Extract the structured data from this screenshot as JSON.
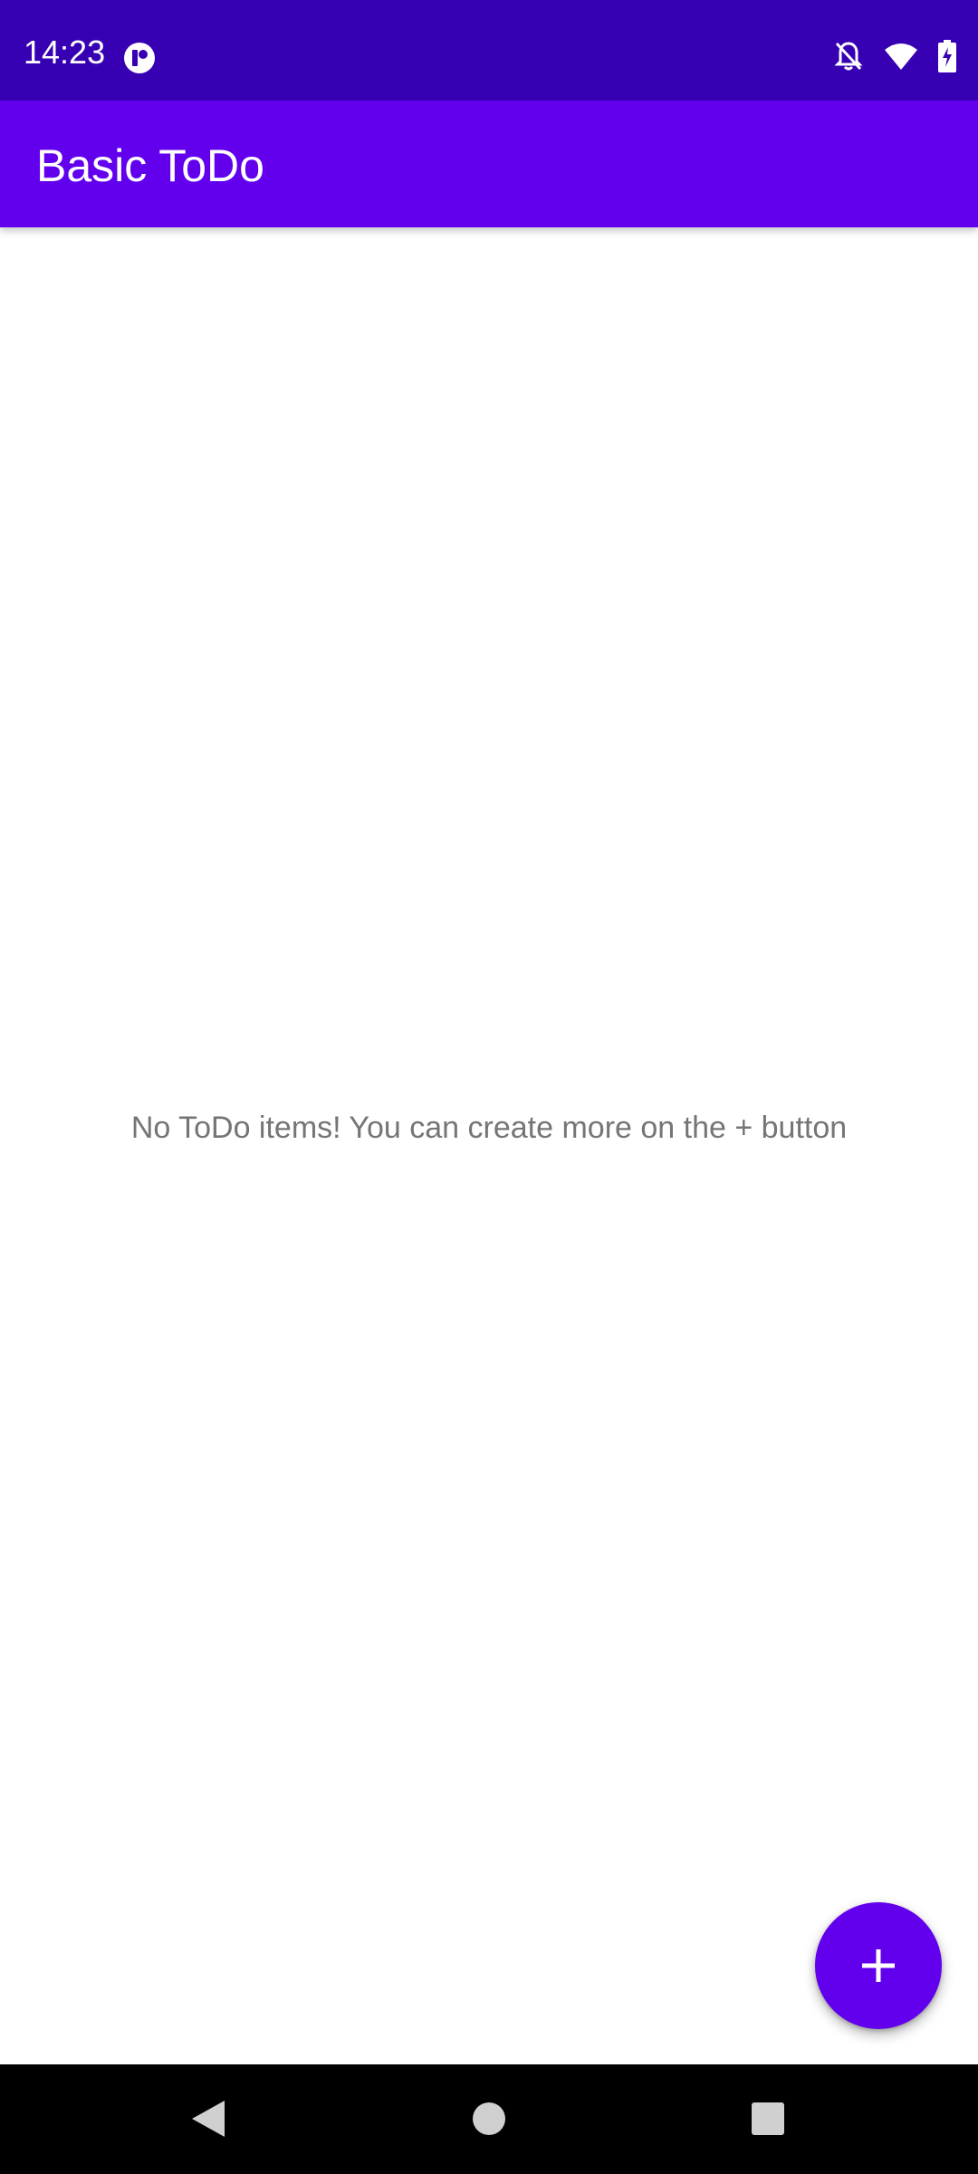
{
  "status_bar": {
    "time": "14:23",
    "bg_color": "#3700b3",
    "icons": [
      "app-notification-icon",
      "bell-off-icon",
      "wifi-icon",
      "battery-charging-icon"
    ]
  },
  "app_bar": {
    "title": "Basic ToDo",
    "bg_color": "#6200ee"
  },
  "main": {
    "empty_message": "No ToDo items! You can create more on the + button"
  },
  "fab": {
    "icon": "plus-icon",
    "color": "#6200ee"
  },
  "nav_bar": {
    "buttons": [
      "back-icon",
      "home-icon",
      "recents-icon"
    ]
  }
}
